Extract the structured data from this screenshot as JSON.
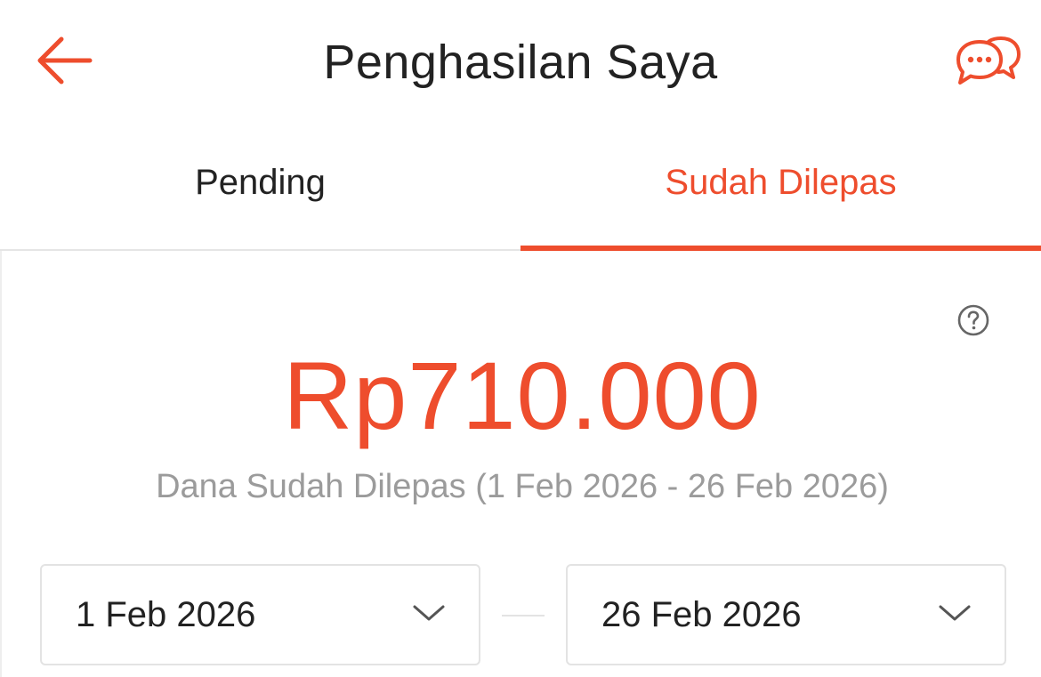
{
  "header": {
    "title": "Penghasilan Saya",
    "back_icon": "arrow-left-icon",
    "chat_icon": "chat-bubbles-icon"
  },
  "tabs": [
    {
      "label": "Pending",
      "active": false
    },
    {
      "label": "Sudah Dilepas",
      "active": true
    }
  ],
  "summary": {
    "amount": "Rp710.000",
    "description": "Dana Sudah Dilepas (1 Feb 2026 - 26 Feb 2026)",
    "help_icon": "question-circle-icon"
  },
  "date_range": {
    "start": "1 Feb 2026",
    "end": "26 Feb 2026",
    "dropdown_icon": "chevron-down-icon"
  },
  "colors": {
    "accent": "#ee4d2d",
    "text": "#222222",
    "muted": "#9b9b9b"
  }
}
